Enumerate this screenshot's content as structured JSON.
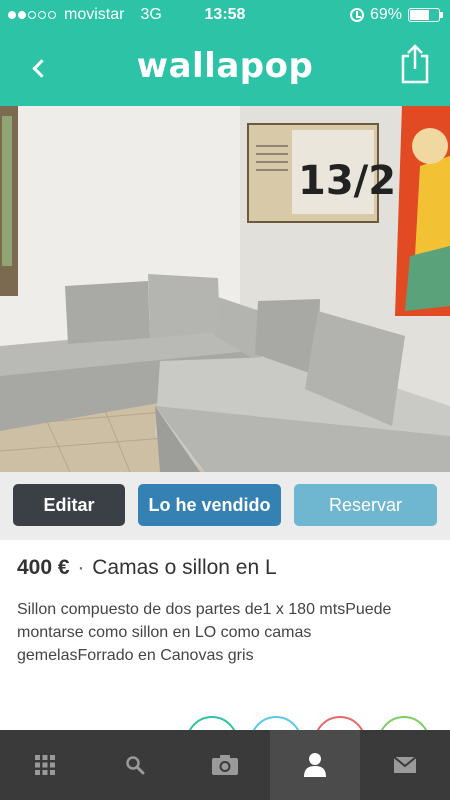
{
  "status_bar": {
    "carrier": "movistar",
    "network": "3G",
    "time": "13:58",
    "battery": "69%",
    "battery_level": 0.69
  },
  "nav": {
    "brand": "wallapop",
    "back_icon": "chevron-left-icon",
    "share_icon": "share-icon"
  },
  "colors": {
    "header": "#2cc3a7",
    "edit": "#3b4046",
    "sold": "#3681b4",
    "reserve": "#6fb6d0",
    "tabbar": "#3a3a3a"
  },
  "actions": {
    "edit_label": "Editar",
    "sold_label": "Lo he vendido",
    "reserve_label": "Reservar"
  },
  "product": {
    "price": "400 €",
    "separator": "·",
    "title": "Camas o sillon en L",
    "description": "Sillon compuesto de dos partes de1 x 180 mtsPuede montarse como sillon en LO como camas gemelasForrado en Canovas gris"
  },
  "tabs": [
    {
      "icon": "grid-icon",
      "active": false
    },
    {
      "icon": "search-icon",
      "active": false
    },
    {
      "icon": "camera-icon",
      "active": false
    },
    {
      "icon": "profile-icon",
      "active": true
    },
    {
      "icon": "mail-icon",
      "active": false
    }
  ]
}
